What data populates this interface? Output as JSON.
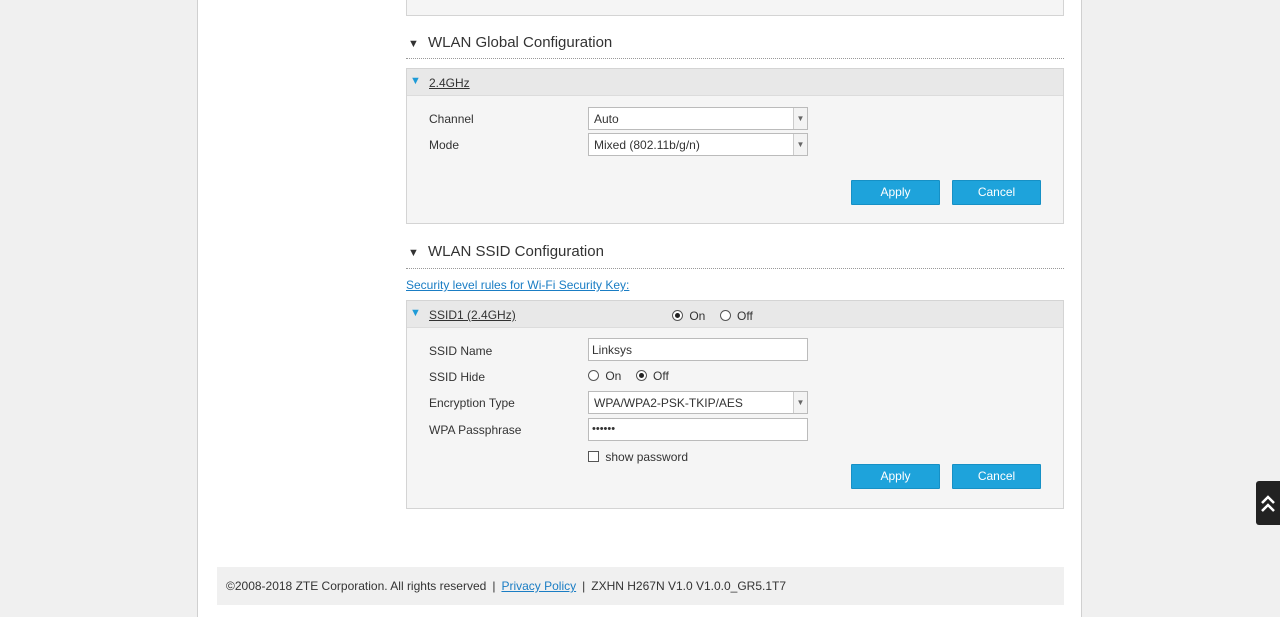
{
  "global_section": {
    "title": "WLAN Global Configuration",
    "panel_title": "2.4GHz",
    "channel": {
      "label": "Channel",
      "value": "Auto"
    },
    "mode": {
      "label": "Mode",
      "value": "Mixed (802.11b/g/n)"
    },
    "apply_label": "Apply",
    "cancel_label": "Cancel"
  },
  "ssid_section": {
    "title": "WLAN SSID Configuration",
    "security_link": "Security level rules for Wi-Fi Security Key:",
    "panel_title": "SSID1 (2.4GHz)",
    "enable": {
      "on_label": "On",
      "off_label": "Off",
      "selected": "On"
    },
    "ssid_name": {
      "label": "SSID Name",
      "value": "Linksys"
    },
    "ssid_hide": {
      "label": "SSID Hide",
      "on_label": "On",
      "off_label": "Off",
      "selected": "Off"
    },
    "encryption": {
      "label": "Encryption Type",
      "value": "WPA/WPA2-PSK-TKIP/AES"
    },
    "passphrase": {
      "label": "WPA Passphrase",
      "value": "••••••"
    },
    "show_password_label": "show password",
    "apply_label": "Apply",
    "cancel_label": "Cancel"
  },
  "footer": {
    "copyright": "©2008-2018 ZTE Corporation. All rights reserved",
    "separator": "|",
    "privacy_link": "Privacy Policy",
    "version": "ZXHN H267N V1.0 V1.0.0_GR5.1T7"
  },
  "icons": {
    "section_toggle": "▼",
    "scroll_top": "double-chevron-up-icon"
  },
  "colors": {
    "accent": "#1ea3db",
    "link": "#1a7dc4"
  }
}
